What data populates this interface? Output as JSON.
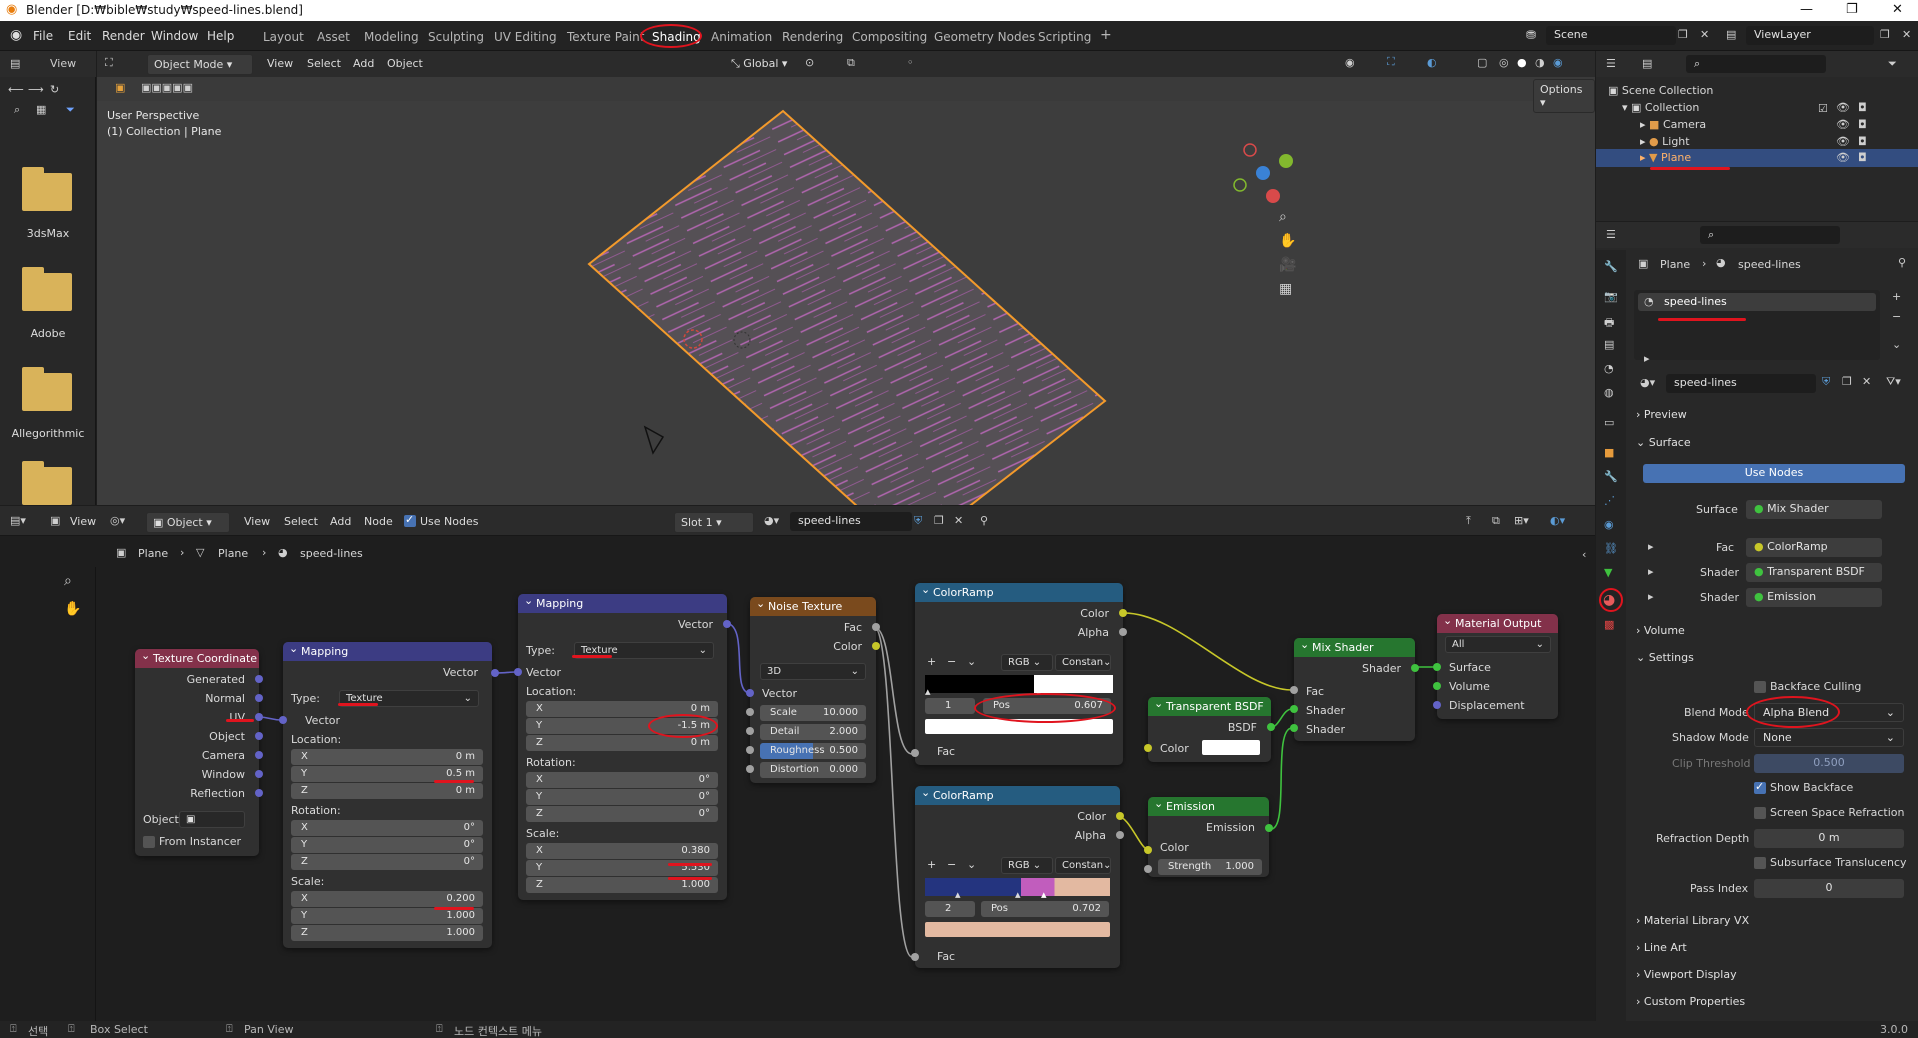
{
  "titlebar": {
    "title": "Blender [D:₩bible₩study₩speed-lines.blend]"
  },
  "menus": [
    "File",
    "Edit",
    "Render",
    "Window",
    "Help"
  ],
  "workspaces": [
    "Layout",
    "Asset",
    "Modeling",
    "Sculpting",
    "UV Editing",
    "Texture Paint",
    "Shading",
    "Animation",
    "Rendering",
    "Compositing",
    "Geometry Nodes",
    "Scripting",
    "+"
  ],
  "scene": "Scene",
  "view_layer": "ViewLayer",
  "file_browser": {
    "view_label": "View",
    "folders": [
      "3dsMax",
      "Adobe",
      "Allegorithmic",
      ""
    ]
  },
  "viewport": {
    "mode": "Object Mode",
    "menus": [
      "View",
      "Select",
      "Add",
      "Object"
    ],
    "transform": "Global",
    "options": "Options",
    "info_line1": "User Perspective",
    "info_line2": "(1) Collection | Plane"
  },
  "outliner": {
    "items": [
      {
        "label": "Scene Collection"
      },
      {
        "label": "Collection"
      },
      {
        "label": "Camera"
      },
      {
        "label": "Light"
      },
      {
        "label": "Plane"
      }
    ]
  },
  "properties": {
    "breadcrumb_object": "Plane",
    "breadcrumb_material": "speed-lines",
    "slot_name": "speed-lines",
    "material_name": "speed-lines",
    "sections": {
      "preview": "Preview",
      "surface": "Surface",
      "volume": "Volume",
      "settings": "Settings",
      "mat_library": "Material Library VX",
      "line_art": "Line Art",
      "viewport_display": "Viewport Display",
      "custom_props": "Custom Properties"
    },
    "use_nodes": "Use Nodes",
    "surface_label": "Surface",
    "surface_value": "Mix Shader",
    "fac_label": "Fac",
    "fac_value": "ColorRamp",
    "shader1_label": "Shader",
    "shader1_value": "Transparent BSDF",
    "shader2_label": "Shader",
    "shader2_value": "Emission",
    "backface_culling": "Backface Culling",
    "blend_mode_label": "Blend Mode",
    "blend_mode": "Alpha Blend",
    "shadow_mode_label": "Shadow Mode",
    "shadow_mode": "None",
    "clip_threshold_label": "Clip Threshold",
    "clip_threshold": "0.500",
    "show_backface": "Show Backface",
    "ssr": "Screen Space Refraction",
    "refraction_depth_label": "Refraction Depth",
    "refraction_depth": "0 m",
    "sss": "Subsurface Translucency",
    "pass_index_label": "Pass Index",
    "pass_index": "0"
  },
  "node_editor": {
    "editor_type": "View",
    "object_menu": "Object",
    "menus": [
      "View",
      "Select",
      "Add",
      "Node"
    ],
    "use_nodes": "Use Nodes",
    "slot": "Slot 1",
    "material": "speed-lines",
    "breadcrumb": [
      "Plane",
      "Plane",
      "speed-lines"
    ]
  },
  "nodes": {
    "texcoord": {
      "title": "Texture Coordinate",
      "outputs": [
        "Generated",
        "Normal",
        "UV",
        "Object",
        "Camera",
        "Window",
        "Reflection"
      ],
      "object_label": "Object:",
      "from_instancer": "From Instancer"
    },
    "mapping1": {
      "title": "Mapping",
      "vector_out": "Vector",
      "type_label": "Type:",
      "type": "Texture",
      "vector_in": "Vector",
      "location": "Location:",
      "loc": [
        "0 m",
        "0.5 m",
        "0 m"
      ],
      "rotation": "Rotation:",
      "rot": [
        "0°",
        "0°",
        "0°"
      ],
      "scale": "Scale:",
      "scl": [
        "0.200",
        "1.000",
        "1.000"
      ]
    },
    "mapping2": {
      "title": "Mapping",
      "vector_out": "Vector",
      "type_label": "Type:",
      "type": "Texture",
      "vector_in": "Vector",
      "location": "Location:",
      "loc": [
        "0 m",
        "-1.5 m",
        "0 m"
      ],
      "rotation": "Rotation:",
      "rot": [
        "0°",
        "0°",
        "0°"
      ],
      "scale": "Scale:",
      "scl": [
        "0.380",
        "5.530",
        "1.000"
      ]
    },
    "noise": {
      "title": "Noise Texture",
      "fac": "Fac",
      "color": "Color",
      "dim": "3D",
      "vector": "Vector",
      "scale_label": "Scale",
      "scale": "10.000",
      "detail_label": "Detail",
      "detail": "2.000",
      "rough_label": "Roughness",
      "rough": "0.500",
      "dist_label": "Distortion",
      "dist": "0.000"
    },
    "ramp1": {
      "title": "ColorRamp",
      "color": "Color",
      "alpha": "Alpha",
      "mode": "RGB",
      "interp": "Constan",
      "index": "1",
      "pos_label": "Pos",
      "pos": "0.607",
      "fac": "Fac"
    },
    "ramp2": {
      "title": "ColorRamp",
      "color": "Color",
      "alpha": "Alpha",
      "mode": "RGB",
      "interp": "Constan",
      "index": "2",
      "pos_label": "Pos",
      "pos": "0.702",
      "fac": "Fac"
    },
    "transparent": {
      "title": "Transparent BSDF",
      "bsdf": "BSDF",
      "color": "Color"
    },
    "emission": {
      "title": "Emission",
      "emission": "Emission",
      "color": "Color",
      "strength_label": "Strength",
      "strength": "1.000"
    },
    "mix": {
      "title": "Mix Shader",
      "shader_out": "Shader",
      "fac": "Fac",
      "shader1": "Shader",
      "shader2": "Shader"
    },
    "output": {
      "title": "Material Output",
      "target": "All",
      "surface": "Surface",
      "volume": "Volume",
      "displacement": "Displacement"
    }
  },
  "statusbar": {
    "select": "선택",
    "box_select": "Box Select",
    "pan_view": "Pan View",
    "context_menu": "노드 컨텍스트 메뉴",
    "version": "3.0.0"
  }
}
